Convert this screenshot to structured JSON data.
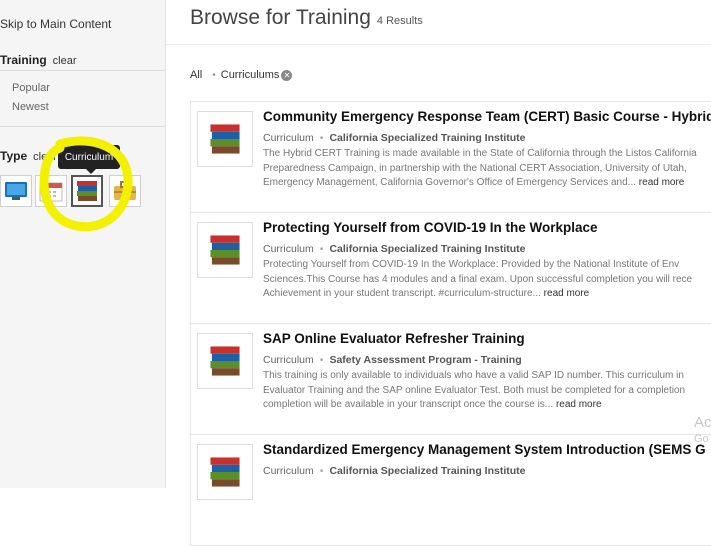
{
  "sidebar": {
    "skip_link": "Skip to Main Content",
    "training_section": {
      "title": "Training",
      "clear": "clear"
    },
    "sort_options": [
      "Popular",
      "Newest"
    ],
    "type_section": {
      "title": "Type",
      "clear": "clear"
    },
    "type_icons": [
      "monitor-icon",
      "calendar-icon",
      "books-icon",
      "briefcase-icon"
    ],
    "tooltip": "Curriculum",
    "highlight_color": "#f3f000"
  },
  "main": {
    "title": "Browse for Training",
    "count": "4 Results",
    "filters": {
      "all": "All",
      "curriculums": "Curriculums"
    },
    "results": [
      {
        "title": "Community Emergency Response Team (CERT) Basic Course - Hybrid",
        "type": "Curriculum",
        "provider": "California Specialized Training Institute",
        "desc_lines": [
          "The Hybrid CERT Training is made available in the State of California through the Listos California",
          "Preparedness Campaign, in partnership with the National CERT Association, University of Utah,",
          "Emergency Management, California Governor's Office of Emergency Services and..."
        ],
        "more": "read more"
      },
      {
        "title": "Protecting Yourself from COVID-19 In the Workplace",
        "type": "Curriculum",
        "provider": "California Specialized Training Institute",
        "desc_lines": [
          "Protecting Yourself from COVID-19 In the Workplace: Provided by the National Institute of Env",
          "Sciences.This Course has 4 modules and a final exam. Upon successful completion you will rece",
          "Achievement in your student transcript. #curriculum-structure..."
        ],
        "more": "read more"
      },
      {
        "title": "SAP Online Evaluator Refresher Training",
        "type": "Curriculum",
        "provider": "Safety Assessment Program - Training",
        "desc_lines": [
          "This training is only available to individuals who have a valid SAP ID number. This curriculum in",
          "Evaluator Training and the SAP online Evaluator Test. Both must be completed for a completion",
          "completion will be available in your transcript once the course is..."
        ],
        "more": "read more"
      },
      {
        "title": "Standardized Emergency Management System Introduction (SEMS G",
        "type": "Curriculum",
        "provider": "California Specialized Training Institute",
        "desc_lines": [],
        "more": ""
      }
    ]
  },
  "watermark": {
    "line1": "Ac",
    "line2": "Go"
  }
}
